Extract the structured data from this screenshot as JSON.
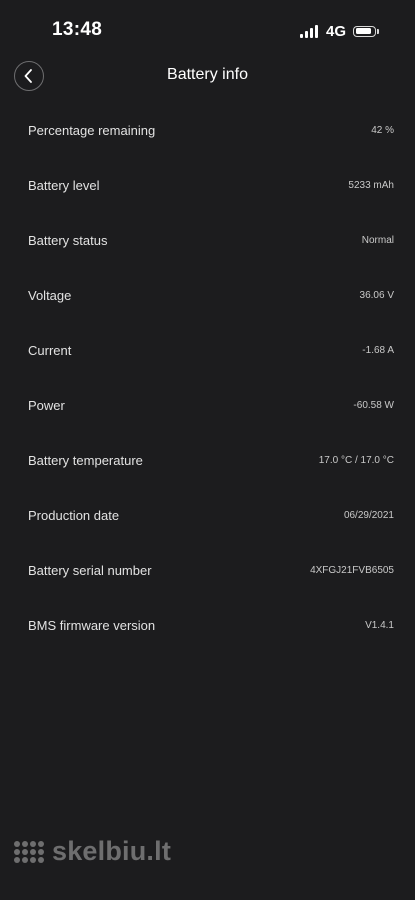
{
  "status_bar": {
    "time": "13:48",
    "network": "4G",
    "signal_bars": 4,
    "battery_level": 0.85
  },
  "header": {
    "title": "Battery info",
    "back_icon": "chevron-left-icon"
  },
  "rows": [
    {
      "label": "Percentage remaining",
      "value": "42 %"
    },
    {
      "label": "Battery level",
      "value": "5233 mAh"
    },
    {
      "label": "Battery status",
      "value": "Normal"
    },
    {
      "label": "Voltage",
      "value": "36.06 V"
    },
    {
      "label": "Current",
      "value": "-1.68 A"
    },
    {
      "label": "Power",
      "value": "-60.58 W"
    },
    {
      "label": "Battery temperature",
      "value": "17.0 °C / 17.0 °C"
    },
    {
      "label": "Production date",
      "value": "06/29/2021"
    },
    {
      "label": "Battery serial number",
      "value": "4XFGJ21FVB6505"
    },
    {
      "label": "BMS firmware version",
      "value": "V1.4.1"
    }
  ],
  "watermark": {
    "text": "skelbiu.lt"
  },
  "colors": {
    "background": "#1c1c1e",
    "text": "#e6e6e6",
    "value_text": "#c9c9c9"
  }
}
